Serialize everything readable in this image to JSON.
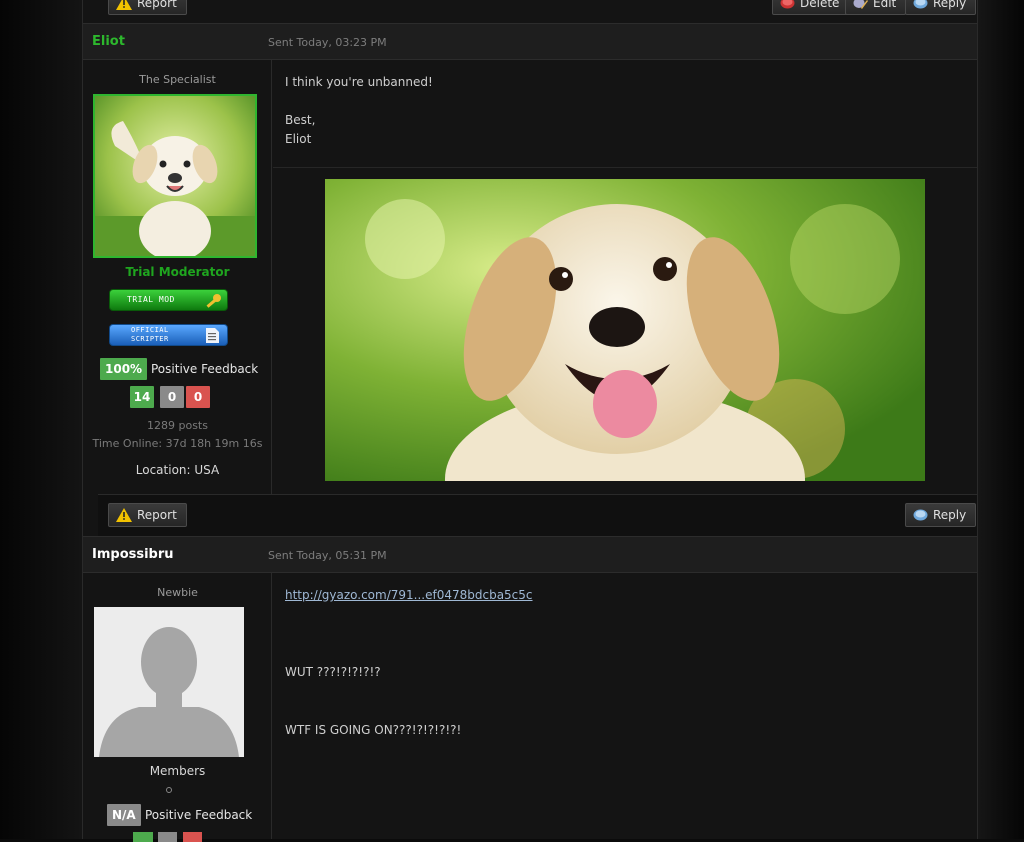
{
  "top_actions": {
    "report_label": "Report",
    "delete_label": "Delete",
    "edit_label": "Edit",
    "reply_label": "Reply"
  },
  "posts": [
    {
      "author": "Eliot",
      "author_color": "#2db82d",
      "sent": "Sent Today, 03:23 PM",
      "user_title": "The Specialist",
      "group": "Trial Moderator",
      "group_color": "#1fa51f",
      "badge_trial_mod": "TRIAL MOD",
      "badge_official_scripter_line1": "OFFICIAL",
      "badge_official_scripter_line2": "SCRIPTER",
      "feedback_pct": "100%",
      "feedback_label": "Positive Feedback",
      "feedback_counts": [
        "14",
        "0",
        "0"
      ],
      "posts_count": "1289 posts",
      "time_online": "Time Online: 37d 18h 19m 16s",
      "location": "Location: USA",
      "message_lines": [
        "I think you're unbanned!",
        "",
        "Best,",
        "Eliot"
      ],
      "image_alt": "puppy-photo",
      "report_label": "Report",
      "reply_label": "Reply"
    },
    {
      "author": "Impossibru",
      "author_color": "#ffffff",
      "sent": "Sent Today, 05:31 PM",
      "user_title": "Newbie",
      "group": "Members",
      "feedback_pct": "N/A",
      "feedback_label": "Positive Feedback",
      "link_text": "http://gyazo.com/791...ef0478bdcba5c5c",
      "message_line1": "WUT ???!?!?!?!?",
      "message_line2": "WTF IS GOING ON???!?!?!?!?!"
    }
  ]
}
